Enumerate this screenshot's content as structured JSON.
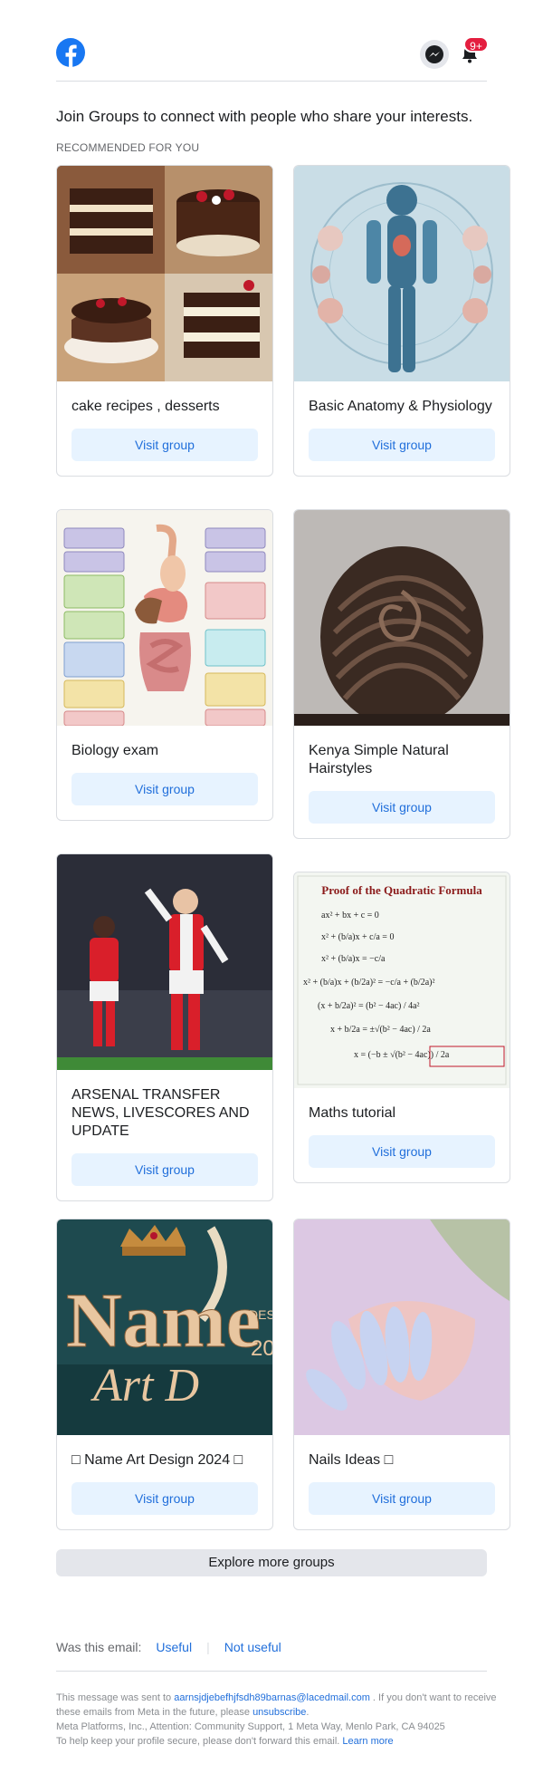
{
  "header": {
    "logo": "facebook-logo",
    "messenger_icon": "messenger-icon",
    "notifications_icon": "bell-icon",
    "notifications_badge": "9+",
    "brand_color": "#1877f2",
    "badge_color": "#e41e3f"
  },
  "intro": "Join Groups to connect with people who share your interests.",
  "section_label": "RECOMMENDED FOR YOU",
  "groups": [
    {
      "name": "cake recipes , desserts",
      "visit": "Visit group",
      "image": "chocolate-cakes-photo"
    },
    {
      "name": "Basic Anatomy & Physiology",
      "visit": "Visit group",
      "image": "human-anatomy-illustration"
    },
    {
      "name": "Biology exam",
      "visit": "Visit group",
      "image": "digestive-system-diagram"
    },
    {
      "name": "Kenya Simple Natural Hairstyles",
      "visit": "Visit group",
      "image": "cornrow-braids-photo"
    },
    {
      "name": "ARSENAL TRANSFER NEWS, LIVESCORES AND UPDATE",
      "visit": "Visit group",
      "image": "football-players-photo"
    },
    {
      "name": "Maths tutorial",
      "visit": "Visit group",
      "image": "quadratic-formula-proof",
      "image_title": "Proof of the Quadratic Formula"
    },
    {
      "name": "□ Name Art Design 2024 □",
      "visit": "Visit group",
      "image": "name-art-design-graphic"
    },
    {
      "name": "Nails Ideas □",
      "visit": "Visit group",
      "image": "manicured-nails-photo"
    }
  ],
  "explore_button": "Explore more groups",
  "feedback": {
    "question": "Was this email:",
    "useful": "Useful",
    "separator": "|",
    "not_useful": "Not useful"
  },
  "footer": {
    "sent_prefix": "This message was sent to",
    "email": "aarnsjdjebefhjfsdh89barnas@lacedmail.com",
    "sent_suffix": ". If you don't want to receive these emails from Meta in the future, please",
    "unsubscribe": "unsubscribe",
    "period": ".",
    "address": "Meta Platforms, Inc., Attention: Community Support, 1 Meta Way, Menlo Park, CA 94025",
    "secure_text": "To help keep your profile secure, please don't forward this email.",
    "learn_more": "Learn more"
  }
}
